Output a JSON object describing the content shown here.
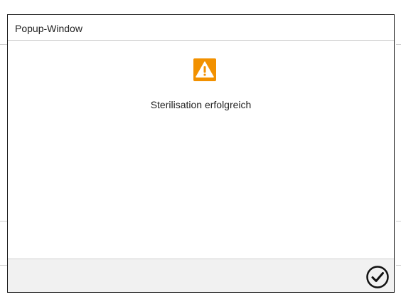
{
  "popup": {
    "title": "Popup-Window",
    "message": "Sterilisation erfolgreich",
    "icon": "warning-icon",
    "accent_color": "#f29100",
    "confirm_icon": "check-circle-icon"
  }
}
